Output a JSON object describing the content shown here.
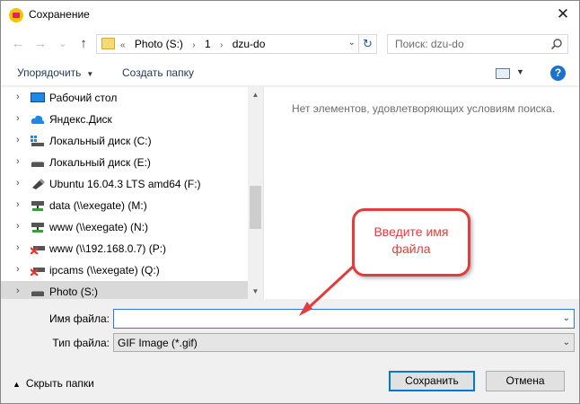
{
  "window": {
    "title": "Сохранение",
    "close": "✕"
  },
  "nav": {
    "back": "←",
    "forward": "→",
    "recent": "⌄",
    "up": "↑"
  },
  "address": {
    "crumbs": [
      "«",
      "Photo (S:)",
      "›",
      "1",
      "›",
      "dzu-do"
    ],
    "dropdown": "⌄",
    "refresh": "↻"
  },
  "search": {
    "placeholder": "Поиск: dzu-do"
  },
  "toolbar": {
    "organize": "Упорядочить",
    "organize_dd": "▼",
    "new_folder": "Создать папку",
    "view_dd": "▼",
    "help": "?"
  },
  "tree": {
    "chevron": "›",
    "items": [
      {
        "label": "Рабочий стол",
        "icon": "desktop-icon"
      },
      {
        "label": "Яндекс.Диск",
        "icon": "cloud-icon"
      },
      {
        "label": "Локальный диск (C:)",
        "icon": "windows-drive-icon"
      },
      {
        "label": "Локальный диск (E:)",
        "icon": "drive-icon"
      },
      {
        "label": "Ubuntu 16.04.3 LTS amd64 (F:)",
        "icon": "usb-drive-icon"
      },
      {
        "label": "data (\\\\exegate) (M:)",
        "icon": "network-drive-icon"
      },
      {
        "label": "www (\\\\exegate) (N:)",
        "icon": "network-drive-icon"
      },
      {
        "label": "www (\\\\192.168.0.7) (P:)",
        "icon": "disconnected-drive-icon"
      },
      {
        "label": "ipcams (\\\\exegate) (Q:)",
        "icon": "disconnected-drive-icon"
      },
      {
        "label": "Photo (S:)",
        "icon": "drive-icon",
        "selected": true
      }
    ]
  },
  "scroll": {
    "up": "▲",
    "down": "▼"
  },
  "content": {
    "empty_message": "Нет элементов, удовлетворяющих условиям поиска."
  },
  "callout": {
    "line1": "Введите имя",
    "line2": "файла"
  },
  "form": {
    "filename_label": "Имя файла:",
    "filename_value": "",
    "filetype_label": "Тип файла:",
    "filetype_value": "GIF Image (*.gif)",
    "dd": "⌄"
  },
  "footer": {
    "caret": "▲",
    "hide_folders": "Скрыть папки",
    "save": "Сохранить",
    "cancel": "Отмена"
  },
  "colors": {
    "accent": "#0078d7",
    "callout": "#e23c3c",
    "selected": "#d9d9d9"
  }
}
